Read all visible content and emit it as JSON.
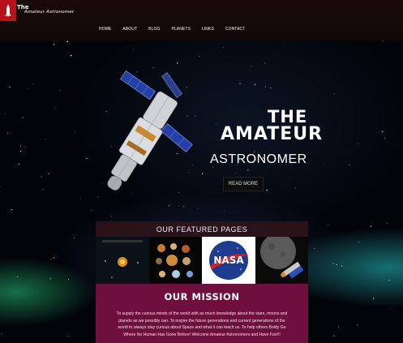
{
  "brand": {
    "logo_the": "The",
    "logo_name": "Amateur Astronomer"
  },
  "nav": {
    "items": [
      "HOME",
      "ABOUT",
      "BLOG",
      "PLANETS",
      "LINKS",
      "CONTACT"
    ]
  },
  "hero": {
    "title_line1": "THE",
    "title_line2": "AMATEUR",
    "subtitle": "ASTRONOMER",
    "button_label": "READ MORE"
  },
  "featured": {
    "title": "OUR FEATURED PAGES",
    "thumbnails": [
      "solar-system-diagram",
      "planets",
      "nasa-logo",
      "spacecraft-over-moon"
    ],
    "nasa_text": "NASA"
  },
  "mission": {
    "title": "OUR MISSION",
    "text": "To supply the curious minds of the world with as much knowledge about the stars, moons and planets as we possibly can. To inspire the future generations and current generations of the world to always stay curious about Space and what it can teach us. To help others Boldy Go Where No Human Has Gone Before! Welcome Amateur Astronomers and Have Fun!!!"
  },
  "colors": {
    "accent_red": "#b5121b",
    "mission_bg": "#6e0f3e",
    "header_bg": "#1a0b0b"
  }
}
